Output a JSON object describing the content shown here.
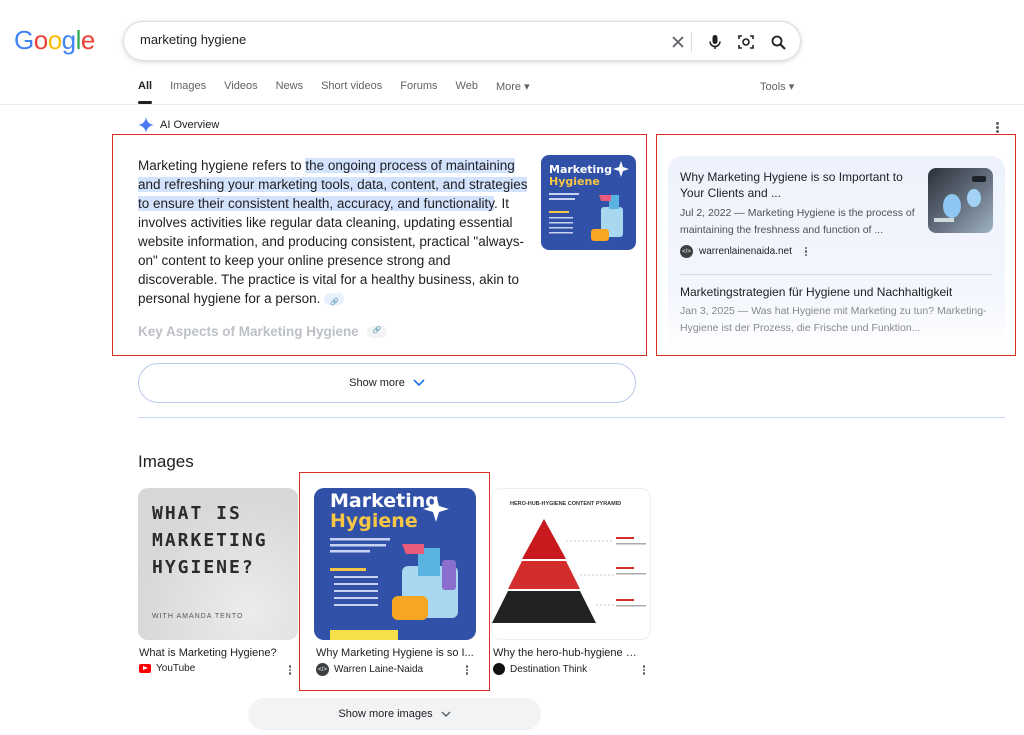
{
  "header": {
    "logo": [
      "G",
      "o",
      "o",
      "g",
      "l",
      "e"
    ],
    "logo_colors": [
      "#4285F4",
      "#EA4335",
      "#FBBC05",
      "#4285F4",
      "#34A853",
      "#EA4335"
    ],
    "query": "marketing hygiene"
  },
  "tabs": [
    {
      "label": "All",
      "active": true
    },
    {
      "label": "Images"
    },
    {
      "label": "Videos"
    },
    {
      "label": "News"
    },
    {
      "label": "Short videos"
    },
    {
      "label": "Forums"
    },
    {
      "label": "Web"
    },
    {
      "label": "More ▾"
    }
  ],
  "tools_label": "Tools ▾",
  "ai_overview": {
    "label": "AI Overview",
    "text_pre": "Marketing hygiene refers to ",
    "text_highlight": "the ongoing process of maintaining and refreshing your marketing tools, data, content, and strategies to ensure their consistent health, accuracy, and functionality",
    "text_post": ". It involves activities like regular data cleaning, updating essential website information, and producing consistent, practical \"always-on\" content to keep your online presence strong and discoverable. The practice is vital for a healthy business, akin to personal hygiene for a person.",
    "key_aspects": "Key Aspects of Marketing Hygiene",
    "thumb_title1": "Marketing",
    "thumb_title2": "Hygiene",
    "show_more": "Show more"
  },
  "sources": [
    {
      "title": "Why Marketing Hygiene is so Important to Your Clients and ...",
      "snippet": "Jul 2, 2022 — Marketing Hygiene is the process of maintaining the freshness and function of ...",
      "site": "warrenlainenaida.net"
    },
    {
      "title": "Marketingstrategien für Hygiene und Nachhaltigkeit",
      "snippet": "Jan 3, 2025 — Was hat Hygiene mit Marketing zu tun? Marketing-Hygiene ist der Prozess, die Frische und Funktion..."
    }
  ],
  "images": {
    "heading": "Images",
    "items": [
      {
        "caption": "What is Marketing Hygiene?",
        "source": "YouTube",
        "art_line1": "WHAT IS",
        "art_line2": "MARKETING",
        "art_line3": "HYGIENE?",
        "art_small": "WITH AMANDA TENTO"
      },
      {
        "caption": "Why Marketing Hygiene is so I...",
        "source": "Warren Laine-Naida",
        "art_line1": "Marketing",
        "art_line2": "Hygiene"
      },
      {
        "caption": "Why the hero-hub-hygiene c...",
        "source": "Destination Think",
        "art_line1": "HERO-HUB-HYGIENE CONTENT PYRAMID"
      }
    ],
    "show_more": "Show more images"
  }
}
